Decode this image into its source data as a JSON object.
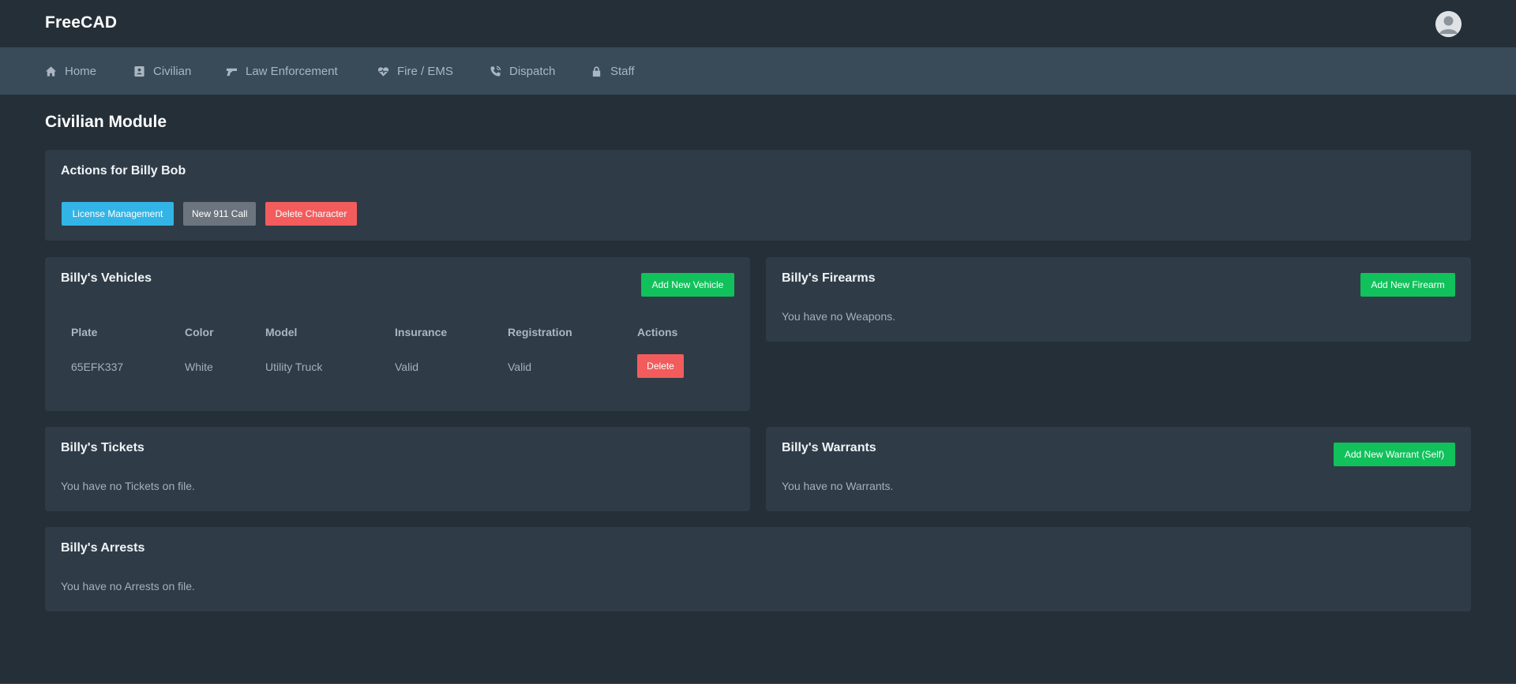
{
  "app": {
    "brand": "FreeCAD"
  },
  "nav": {
    "items": [
      {
        "label": "Home",
        "icon": "home-icon"
      },
      {
        "label": "Civilian",
        "icon": "id-card-icon"
      },
      {
        "label": "Law Enforcement",
        "icon": "gun-icon"
      },
      {
        "label": "Fire / EMS",
        "icon": "heartbeat-icon"
      },
      {
        "label": "Dispatch",
        "icon": "phone-icon"
      },
      {
        "label": "Staff",
        "icon": "lock-icon"
      }
    ]
  },
  "page": {
    "title": "Civilian Module"
  },
  "actions": {
    "title": "Actions for Billy Bob",
    "license_label": "License Management",
    "call_label": "New 911 Call",
    "delete_label": "Delete Character"
  },
  "vehicles": {
    "title": "Billy's Vehicles",
    "add_label": "Add New Vehicle",
    "columns": [
      "Plate",
      "Color",
      "Model",
      "Insurance",
      "Registration",
      "Actions"
    ],
    "rows": [
      {
        "plate": "65EFK337",
        "color": "White",
        "model": "Utility Truck",
        "insurance": "Valid",
        "registration": "Valid",
        "delete_label": "Delete"
      }
    ]
  },
  "firearms": {
    "title": "Billy's Firearms",
    "add_label": "Add New Firearm",
    "empty": "You have no Weapons."
  },
  "tickets": {
    "title": "Billy's Tickets",
    "empty": "You have no Tickets on file."
  },
  "warrants": {
    "title": "Billy's Warrants",
    "add_label": "Add New Warrant (Self)",
    "empty": "You have no Warrants."
  },
  "arrests": {
    "title": "Billy's Arrests",
    "empty": "You have no Arrests on file."
  },
  "colors": {
    "info": "#32b5e6",
    "secondary": "#6c757d",
    "danger": "#f25c5c",
    "success": "#11c15b",
    "navbar": "#394b59",
    "background": "#252f38",
    "card": "#2f3c47"
  }
}
